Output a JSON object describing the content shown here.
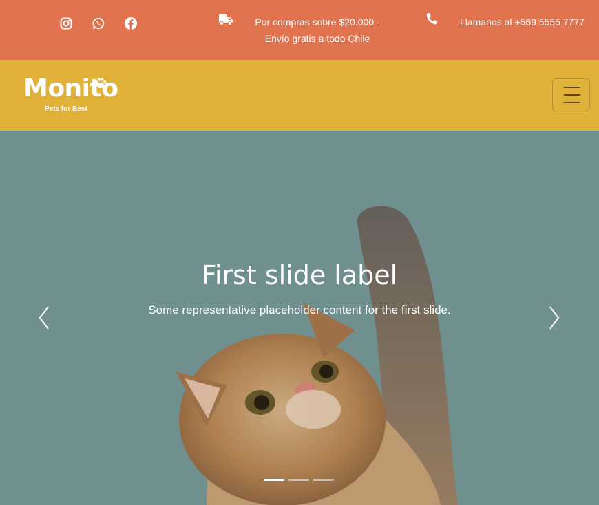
{
  "topbar": {
    "social": [
      {
        "name": "instagram-icon"
      },
      {
        "name": "whatsapp-icon"
      },
      {
        "name": "facebook-icon"
      }
    ],
    "shipping_icon": "truck-icon",
    "shipping_line1": "Por compras sobre $20.000 -",
    "shipping_line2": "Envío gratis a todo Chile",
    "phone_icon": "phone-icon",
    "phone_text": "Llamanos al +569 5555 7777",
    "background": "#e2734f"
  },
  "navbar": {
    "logo_word": "Monito",
    "logo_tagline": "Pets for Best",
    "toggler_icon": "hamburger-menu-icon",
    "background": "#e0b139"
  },
  "carousel": {
    "slide_title": "First slide label",
    "slide_text": "Some representative placeholder content for the first slide.",
    "prev_icon": "chevron-left-icon",
    "next_icon": "chevron-right-icon",
    "indicator_count": 3,
    "active_indicator": 1
  }
}
